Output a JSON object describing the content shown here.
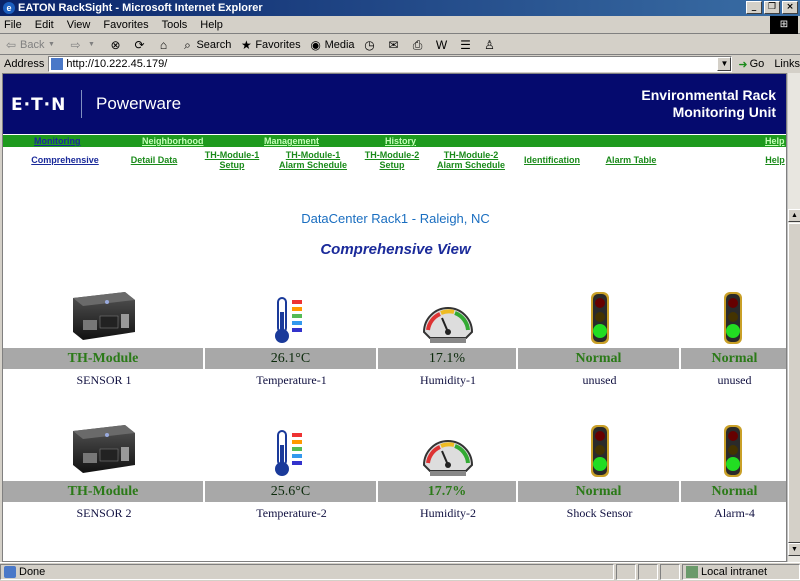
{
  "window": {
    "title": "EATON RackSight - Microsoft Internet Explorer",
    "buttons": [
      "_",
      "❐",
      "×"
    ]
  },
  "menu": [
    "File",
    "Edit",
    "View",
    "Favorites",
    "Tools",
    "Help"
  ],
  "toolbar": {
    "back": "Back",
    "search": "Search",
    "favorites": "Favorites",
    "media": "Media"
  },
  "address": {
    "label": "Address",
    "url": "http://10.222.45.179/",
    "go": "Go",
    "links": "Links"
  },
  "banner": {
    "logo": "E·T·N",
    "brand": "Powerware",
    "title_line1": "Environmental Rack",
    "title_line2": "Monitoring Unit"
  },
  "nav": {
    "items": [
      "Monitoring",
      "Neighborhood",
      "Management",
      "History",
      "Help"
    ],
    "active": "Monitoring"
  },
  "subnav": {
    "items": [
      {
        "line1": "Comprehensive",
        "line2": ""
      },
      {
        "line1": "Detail Data",
        "line2": ""
      },
      {
        "line1": "TH-Module-1",
        "line2": "Setup"
      },
      {
        "line1": "TH-Module-1",
        "line2": "Alarm Schedule"
      },
      {
        "line1": "TH-Module-2",
        "line2": "Setup"
      },
      {
        "line1": "TH-Module-2",
        "line2": "Alarm Schedule"
      },
      {
        "line1": "Identification",
        "line2": ""
      },
      {
        "line1": "Alarm Table",
        "line2": ""
      },
      {
        "line1": "Help",
        "line2": ""
      }
    ]
  },
  "content": {
    "location": "DataCenter Rack1 - Raleigh, NC",
    "view_title": "Comprehensive View",
    "rows": [
      {
        "cells": [
          {
            "icon": "th-module-device-icon",
            "value": "TH-Module",
            "label": "SENSOR 1"
          },
          {
            "icon": "thermometer-icon",
            "value": "26.1°C",
            "label": "Temperature-1"
          },
          {
            "icon": "humidity-gauge-icon",
            "value": "17.1%",
            "label": "Humidity-1"
          },
          {
            "icon": "traffic-light-icon",
            "value": "Normal",
            "label": "unused"
          },
          {
            "icon": "traffic-light-icon",
            "value": "Normal",
            "label": "unused"
          }
        ]
      },
      {
        "cells": [
          {
            "icon": "th-module-device-icon",
            "value": "TH-Module",
            "label": "SENSOR 2"
          },
          {
            "icon": "thermometer-icon",
            "value": "25.6°C",
            "label": "Temperature-2"
          },
          {
            "icon": "humidity-gauge-icon",
            "value": "17.7%",
            "label": "Humidity-2"
          },
          {
            "icon": "traffic-light-icon",
            "value": "Normal",
            "label": "Shock Sensor"
          },
          {
            "icon": "traffic-light-icon",
            "value": "Normal",
            "label": "Alarm-4"
          }
        ]
      }
    ]
  },
  "status": {
    "text": "Done",
    "zone": "Local intranet"
  },
  "colors": {
    "banner": "#050a6e",
    "nav_green": "#1e9a1e",
    "value_bar": "#a8a8a8",
    "title_blue": "#1a2a9a"
  }
}
